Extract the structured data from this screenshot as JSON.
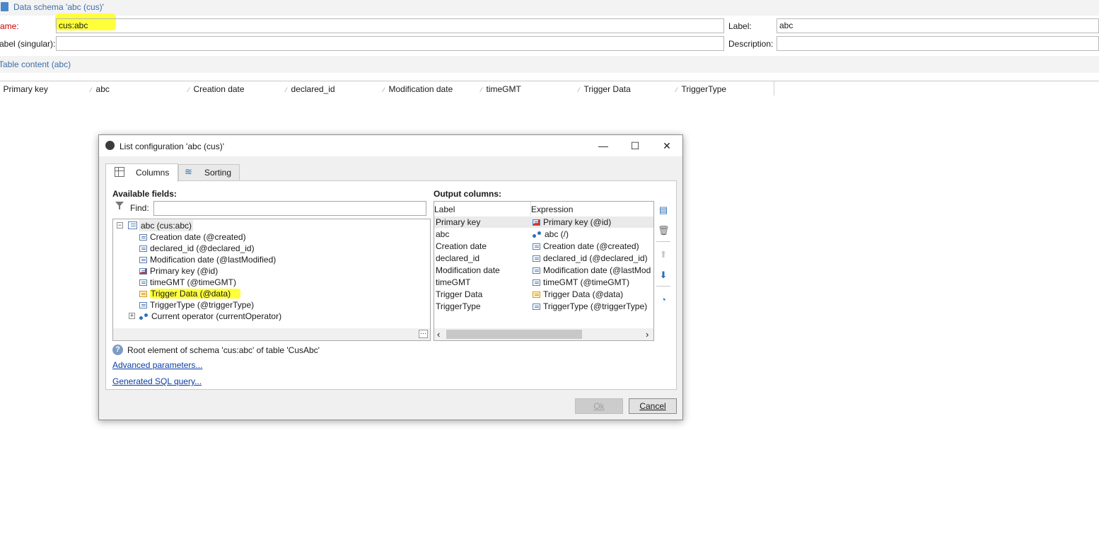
{
  "window": {
    "title": "Data schema 'abc (cus)'"
  },
  "form": {
    "name_label": "ame:",
    "name_value": "cus:abc",
    "label_label": "Label:",
    "label_value": "abc",
    "singular_label": "abel (singular):",
    "singular_value": "",
    "description_label": "Description:",
    "description_value": ""
  },
  "section": {
    "title": "Table content (abc)"
  },
  "table_columns": [
    "Primary key",
    "abc",
    "Creation date",
    "declared_id",
    "Modification date",
    "timeGMT",
    "Trigger Data",
    "TriggerType"
  ],
  "dialog": {
    "title": "List configuration 'abc (cus)'",
    "tabs": [
      {
        "label": "Columns",
        "active": true
      },
      {
        "label": "Sorting",
        "active": false
      }
    ],
    "available_fields_label": "Available fields:",
    "find_label": "Find:",
    "find_value": "",
    "tree": {
      "root": "abc (cus:abc)",
      "children": [
        {
          "label": "Creation date (@created)",
          "icon": "field-icon"
        },
        {
          "label": "declared_id (@declared_id)",
          "icon": "field-icon"
        },
        {
          "label": "Modification date (@lastModified)",
          "icon": "field-icon"
        },
        {
          "label": "Primary key (@id)",
          "icon": "primary-key-icon"
        },
        {
          "label": "timeGMT (@timeGMT)",
          "icon": "field-icon"
        },
        {
          "label": "Trigger Data (@data)",
          "icon": "xml-field-icon",
          "highlighted": true
        },
        {
          "label": "TriggerType (@triggerType)",
          "icon": "field-icon"
        }
      ],
      "collapsed_node": "Current operator (currentOperator)"
    },
    "output_columns_label": "Output columns:",
    "output_headers": {
      "label": "Label",
      "expression": "Expression"
    },
    "output_rows": [
      {
        "label": "Primary key",
        "expression": "Primary key (@id)",
        "icon": "primary-key-icon"
      },
      {
        "label": "abc",
        "expression": "abc (/)",
        "icon": "link-icon"
      },
      {
        "label": "Creation date",
        "expression": "Creation date (@created)",
        "icon": "field-icon"
      },
      {
        "label": "declared_id",
        "expression": "declared_id (@declared_id)",
        "icon": "field-icon"
      },
      {
        "label": "Modification date",
        "expression": "Modification date (@lastMod",
        "icon": "field-icon"
      },
      {
        "label": "timeGMT",
        "expression": "timeGMT (@timeGMT)",
        "icon": "field-icon"
      },
      {
        "label": "Trigger Data",
        "expression": "Trigger Data (@data)",
        "icon": "xml-field-icon"
      },
      {
        "label": "TriggerType",
        "expression": "TriggerType (@triggerType)",
        "icon": "field-icon"
      }
    ],
    "info_text": "Root element of schema 'cus:abc' of table 'CusAbc'",
    "advanced_link": "Advanced parameters...",
    "sql_link": "Generated SQL query...",
    "ok_label": "Ok",
    "cancel_label": "Cancel",
    "minimize_glyph": "—",
    "maximize_glyph": "☐",
    "close_glyph": "✕",
    "ellipsis_glyph": "⋯",
    "scroll_left_glyph": "‹",
    "scroll_right_glyph": "›"
  },
  "colors": {
    "highlight": "#ffff3a",
    "link": "#0a3da8",
    "header_text": "#3b6fa8",
    "required_label": "#cc0000"
  }
}
